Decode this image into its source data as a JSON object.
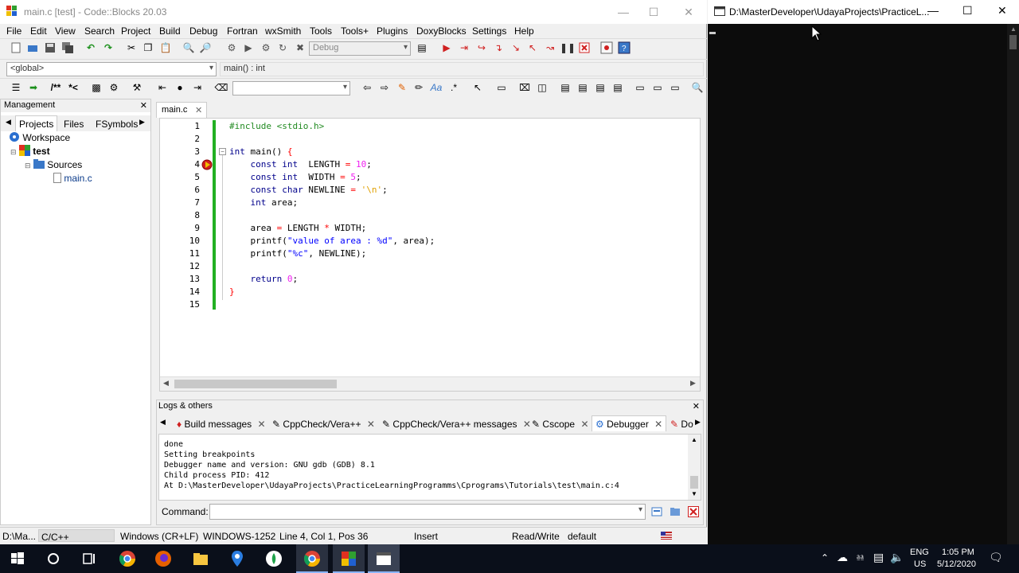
{
  "cb_window": {
    "title": "main.c [test] - Code::Blocks 20.03",
    "menu": [
      "File",
      "Edit",
      "View",
      "Search",
      "Project",
      "Build",
      "Debug",
      "Fortran",
      "wxSmith",
      "Tools",
      "Tools+",
      "Plugins",
      "DoxyBlocks",
      "Settings",
      "Help"
    ],
    "build_target": "Debug",
    "scope_combo": "<global>",
    "function_combo": "main() : int",
    "search_combo": ""
  },
  "management": {
    "title": "Management",
    "tabs": [
      "Projects",
      "Files",
      "FSymbols"
    ],
    "active_tab": "Projects",
    "tree": {
      "workspace": "Workspace",
      "project": "test",
      "folder": "Sources",
      "file": "main.c"
    }
  },
  "editor": {
    "tab_label": "main.c",
    "lines": [
      {
        "n": "1",
        "text": "#include <stdio.h>"
      },
      {
        "n": "2",
        "text": ""
      },
      {
        "n": "3",
        "text": "int main() {"
      },
      {
        "n": "4",
        "text": "    const int  LENGTH = 10;"
      },
      {
        "n": "5",
        "text": "    const int  WIDTH = 5;"
      },
      {
        "n": "6",
        "text": "    const char NEWLINE = '\\n';"
      },
      {
        "n": "7",
        "text": "    int area;"
      },
      {
        "n": "8",
        "text": ""
      },
      {
        "n": "9",
        "text": "    area = LENGTH * WIDTH;"
      },
      {
        "n": "10",
        "text": "    printf(\"value of area : %d\", area);"
      },
      {
        "n": "11",
        "text": "    printf(\"%c\", NEWLINE);"
      },
      {
        "n": "12",
        "text": ""
      },
      {
        "n": "13",
        "text": "    return 0;"
      },
      {
        "n": "14",
        "text": "}"
      },
      {
        "n": "15",
        "text": ""
      }
    ]
  },
  "logs": {
    "title": "Logs & others",
    "tabs": [
      "Build messages",
      "CppCheck/Vera++",
      "CppCheck/Vera++ messages",
      "Cscope",
      "Debugger",
      "Do"
    ],
    "active_tab": "Debugger",
    "lines": [
      "done",
      "Setting breakpoints",
      "Debugger name and version: GNU gdb (GDB) 8.1",
      "Child process PID: 412",
      "At D:\\MasterDeveloper\\UdayaProjects\\PracticeLearningProgramms\\Cprograms\\Tutorials\\test\\main.c:4"
    ],
    "command_label": "Command:",
    "command_value": ""
  },
  "status": {
    "path": "D:\\Ma...",
    "language": "C/C++",
    "eol": "Windows (CR+LF)",
    "encoding": "WINDOWS-1252",
    "position": "Line 4, Col 1, Pos 36",
    "mode": "Insert",
    "access": "Read/Write",
    "profile": "default"
  },
  "console": {
    "title": "D:\\MasterDeveloper\\UdayaProjects\\PracticeL..."
  },
  "taskbar": {
    "lang": "ENG",
    "region": "US",
    "time": "1:05 PM",
    "date": "5/12/2020"
  }
}
